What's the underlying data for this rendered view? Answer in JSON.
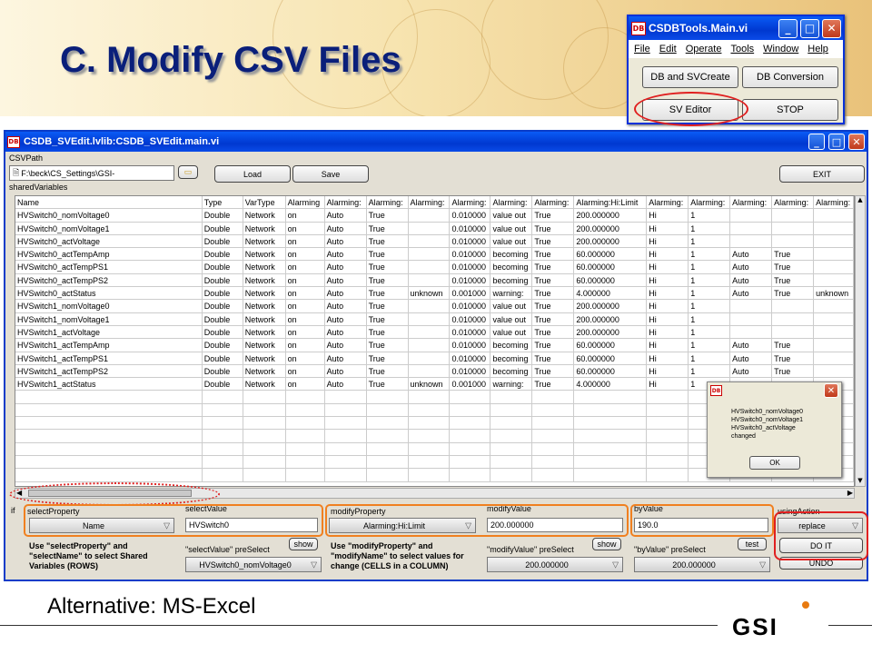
{
  "slide": {
    "title": "C. Modify CSV Files",
    "footer": "Alternative: MS-Excel",
    "logo": "GSI"
  },
  "colors": {
    "title": "#0a1f7a",
    "titlebar": "#0038d0",
    "highlight_red": "#e02020",
    "highlight_orange": "#f08020",
    "panel": "#e3dfd4"
  },
  "main_window": {
    "title": "CSDBTools.Main.vi",
    "icon": "DB",
    "menu": [
      "File",
      "Edit",
      "Operate",
      "Tools",
      "Window",
      "Help"
    ],
    "buttons": [
      "DB and SVCreate",
      "DB Conversion",
      "SV Editor",
      "STOP"
    ]
  },
  "editor": {
    "title": "CSDB_SVEdit.lvlib:CSDB_SVEdit.main.vi",
    "icon": "DB",
    "csv_label": "CSVPath",
    "csv_path": "F:\\beck\\CS_Settings\\GSI-",
    "load": "Load",
    "save": "Save",
    "exit": "EXIT",
    "shared_label": "sharedVariables"
  },
  "table": {
    "headers": [
      "Name",
      "Type",
      "VarType",
      "Alarming",
      "Alarming:",
      "Alarming:",
      "Alarming:",
      "Alarming:",
      "Alarming:",
      "Alarming:",
      "Alarming:Hi:Limit",
      "Alarming:",
      "Alarming:",
      "Alarming:",
      "Alarming:",
      "Alarming:"
    ],
    "rows": [
      [
        "HVSwitch0_nomVoltage0",
        "Double",
        "Network",
        "on",
        "Auto",
        "True",
        "",
        "0.010000",
        "value out",
        "True",
        "200.000000",
        "Hi",
        "1",
        "",
        "",
        ""
      ],
      [
        "HVSwitch0_nomVoltage1",
        "Double",
        "Network",
        "on",
        "Auto",
        "True",
        "",
        "0.010000",
        "value out",
        "True",
        "200.000000",
        "Hi",
        "1",
        "",
        "",
        ""
      ],
      [
        "HVSwitch0_actVoltage",
        "Double",
        "Network",
        "on",
        "Auto",
        "True",
        "",
        "0.010000",
        "value out",
        "True",
        "200.000000",
        "Hi",
        "1",
        "",
        "",
        ""
      ],
      [
        "HVSwitch0_actTempAmp",
        "Double",
        "Network",
        "on",
        "Auto",
        "True",
        "",
        "0.010000",
        "becoming",
        "True",
        "60.000000",
        "Hi",
        "1",
        "Auto",
        "True",
        ""
      ],
      [
        "HVSwitch0_actTempPS1",
        "Double",
        "Network",
        "on",
        "Auto",
        "True",
        "",
        "0.010000",
        "becoming",
        "True",
        "60.000000",
        "Hi",
        "1",
        "Auto",
        "True",
        ""
      ],
      [
        "HVSwitch0_actTempPS2",
        "Double",
        "Network",
        "on",
        "Auto",
        "True",
        "",
        "0.010000",
        "becoming",
        "True",
        "60.000000",
        "Hi",
        "1",
        "Auto",
        "True",
        ""
      ],
      [
        "HVSwitch0_actStatus",
        "Double",
        "Network",
        "on",
        "Auto",
        "True",
        "unknown",
        "0.001000",
        "warning:",
        "True",
        "4.000000",
        "Hi",
        "1",
        "Auto",
        "True",
        "unknown"
      ],
      [
        "HVSwitch1_nomVoltage0",
        "Double",
        "Network",
        "on",
        "Auto",
        "True",
        "",
        "0.010000",
        "value out",
        "True",
        "200.000000",
        "Hi",
        "1",
        "",
        "",
        ""
      ],
      [
        "HVSwitch1_nomVoltage1",
        "Double",
        "Network",
        "on",
        "Auto",
        "True",
        "",
        "0.010000",
        "value out",
        "True",
        "200.000000",
        "Hi",
        "1",
        "",
        "",
        ""
      ],
      [
        "HVSwitch1_actVoltage",
        "Double",
        "Network",
        "on",
        "Auto",
        "True",
        "",
        "0.010000",
        "value out",
        "True",
        "200.000000",
        "Hi",
        "1",
        "",
        "",
        ""
      ],
      [
        "HVSwitch1_actTempAmp",
        "Double",
        "Network",
        "on",
        "Auto",
        "True",
        "",
        "0.010000",
        "becoming",
        "True",
        "60.000000",
        "Hi",
        "1",
        "Auto",
        "True",
        ""
      ],
      [
        "HVSwitch1_actTempPS1",
        "Double",
        "Network",
        "on",
        "Auto",
        "True",
        "",
        "0.010000",
        "becoming",
        "True",
        "60.000000",
        "Hi",
        "1",
        "Auto",
        "True",
        ""
      ],
      [
        "HVSwitch1_actTempPS2",
        "Double",
        "Network",
        "on",
        "Auto",
        "True",
        "",
        "0.010000",
        "becoming",
        "True",
        "60.000000",
        "Hi",
        "1",
        "Auto",
        "True",
        ""
      ],
      [
        "HVSwitch1_actStatus",
        "Double",
        "Network",
        "on",
        "Auto",
        "True",
        "unknown",
        "0.001000",
        "warning:",
        "True",
        "4.000000",
        "Hi",
        "1",
        "",
        "",
        ""
      ]
    ]
  },
  "controls": {
    "if_label": "if",
    "select_property_label": "selectProperty",
    "select_property": "Name",
    "select_value_label": "selectValue",
    "select_value": "HVSwitch0",
    "modify_property_label": "modifyProperty",
    "modify_property": "Alarming:Hi:Limit",
    "modify_value_label": "modifyValue",
    "modify_value": "200.000000",
    "by_value_label": "byValue",
    "by_value": "190.0",
    "using_action_label": "usingAction",
    "using_action": "replace",
    "do_it": "DO IT",
    "undo": "UNDO",
    "help_select": "Use \"selectProperty\" and \"selectName\" to select Shared Variables (ROWS)",
    "help_modify": "Use \"modifyProperty\" and \"modifyName\" to select values for change (CELLS in a COLUMN)",
    "select_preselect_label": "\"selectValue\" preSelect",
    "select_preselect": "HVSwitch0_nomVoltage0",
    "modify_preselect_label": "\"modifyValue\" preSelect",
    "modify_preselect": "200.000000",
    "by_preselect_label": "\"byValue\" preSelect",
    "by_preselect": "200.000000",
    "show": "show",
    "test": "test"
  },
  "popup": {
    "icon": "DB",
    "lines": [
      "HVSwitch0_nomVoltage0",
      "HVSwitch0_nomVoltage1",
      "HVSwitch0_actVoltage",
      "changed"
    ],
    "ok": "OK"
  }
}
